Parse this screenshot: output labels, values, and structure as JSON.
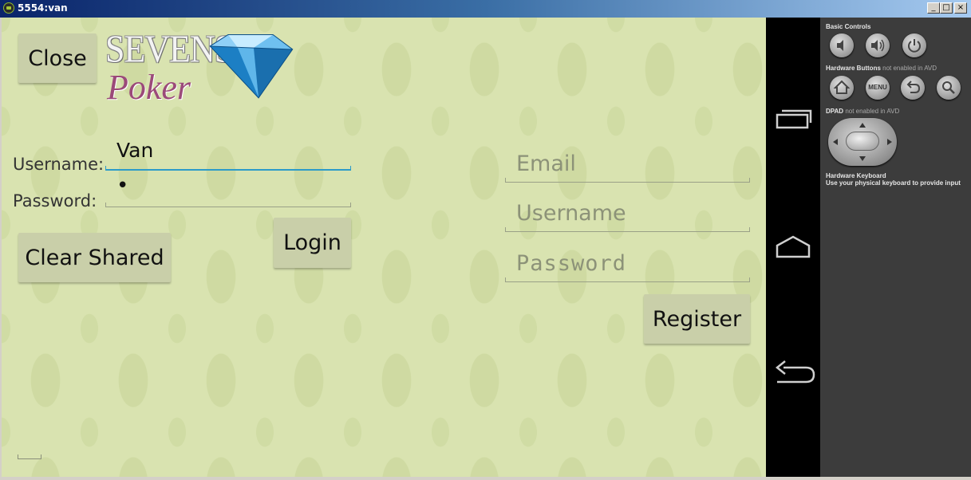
{
  "window": {
    "title": "5554:van",
    "minimize": "_",
    "maximize": "□",
    "close": "×"
  },
  "app": {
    "close_label": "Close",
    "logo_line1": "SEVENS",
    "logo_line2": "Poker",
    "login": {
      "username_label": "Username:",
      "username_value": "Van",
      "password_label": "Password:",
      "password_value": "•",
      "login_label": "Login",
      "clear_shared_label": "Clear Shared"
    },
    "register": {
      "email_placeholder": "Email",
      "username_placeholder": "Username",
      "password_placeholder": "Password",
      "register_label": "Register"
    }
  },
  "emulator_panel": {
    "basic_controls": "Basic Controls",
    "hardware_buttons": "Hardware Buttons",
    "hardware_buttons_note": "not enabled in AVD",
    "menu_label": "MENU",
    "dpad": "DPAD",
    "dpad_note": "not enabled in AVD",
    "keyboard_title": "Hardware Keyboard",
    "keyboard_note": "Use your physical keyboard to provide input"
  },
  "colors": {
    "screen_bg": "#d9e3b0",
    "focus_accent": "#2c9bc9",
    "logo_pink": "#9b4a79",
    "diamond_blue": "#2f9ee0"
  }
}
